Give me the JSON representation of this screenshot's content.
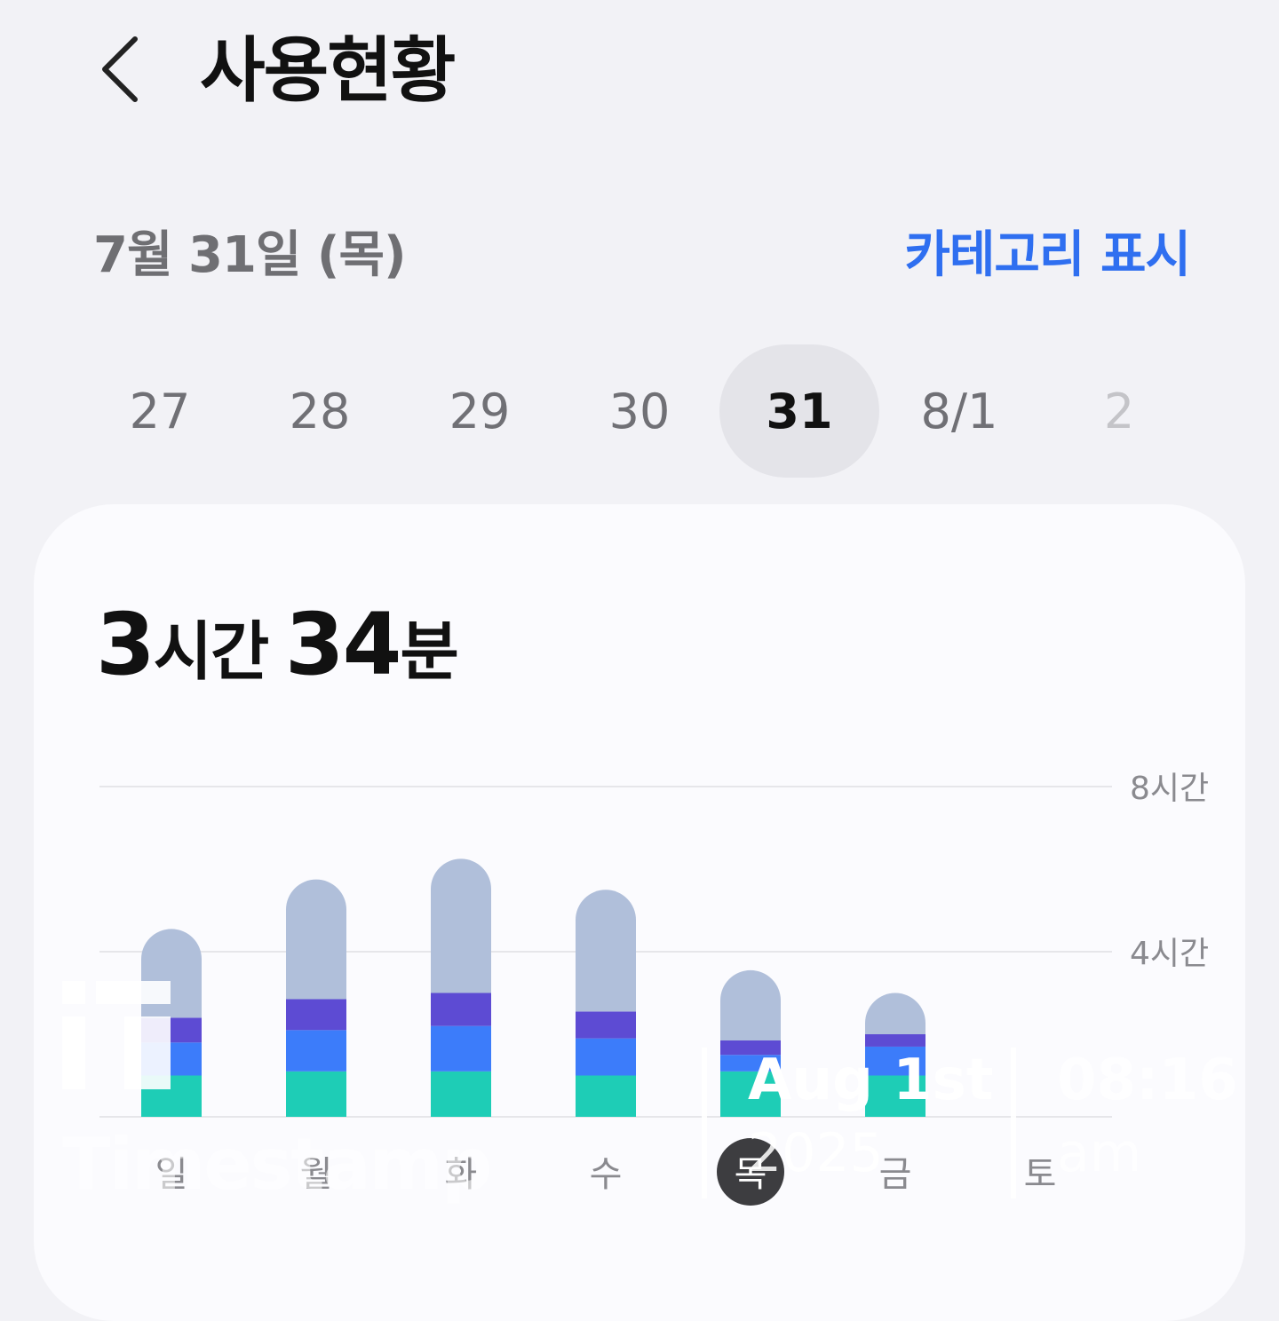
{
  "header": {
    "title": "사용현황",
    "back_icon": "chevron-left-icon"
  },
  "date_row": {
    "date_label": "7월 31일 (목)",
    "category_label": "카테고리 표시"
  },
  "day_strip": {
    "days": [
      {
        "label": "27",
        "state": "past"
      },
      {
        "label": "28",
        "state": "past"
      },
      {
        "label": "29",
        "state": "past"
      },
      {
        "label": "30",
        "state": "past"
      },
      {
        "label": "31",
        "state": "selected"
      },
      {
        "label": "8/1",
        "state": "past"
      },
      {
        "label": "2",
        "state": "future"
      }
    ]
  },
  "summary": {
    "hours_value": "3",
    "hours_unit": "시간",
    "minutes_value": "34",
    "minutes_unit": "분"
  },
  "chart_data": {
    "type": "bar",
    "stacked": true,
    "categories": [
      "일",
      "월",
      "화",
      "수",
      "목",
      "금",
      "토"
    ],
    "selected_category": "목",
    "y_ticks": [
      {
        "value": 8,
        "label": "8시간"
      },
      {
        "value": 4,
        "label": "4시간"
      }
    ],
    "ylim": [
      0,
      8
    ],
    "unit": "hours",
    "series": [
      {
        "color": "#1ecdb6",
        "values": [
          1.0,
          1.1,
          1.1,
          1.0,
          1.1,
          1.0,
          0
        ]
      },
      {
        "color": "#3c7cfa",
        "values": [
          0.8,
          1.0,
          1.1,
          0.9,
          0.4,
          0.7,
          0
        ]
      },
      {
        "color": "#5d4bd3",
        "values": [
          0.6,
          0.75,
          0.8,
          0.65,
          0.35,
          0.3,
          0
        ]
      },
      {
        "color": "#b0bfda",
        "values": [
          2.15,
          2.9,
          3.25,
          2.95,
          1.7,
          1.0,
          0
        ]
      }
    ],
    "grid": true
  },
  "watermark": {
    "brand": "Timestamp",
    "logo_icon": "timestamp-logo-icon",
    "date": "Aug 1st",
    "year": "2025",
    "time": "08:16",
    "ampm": "am"
  }
}
